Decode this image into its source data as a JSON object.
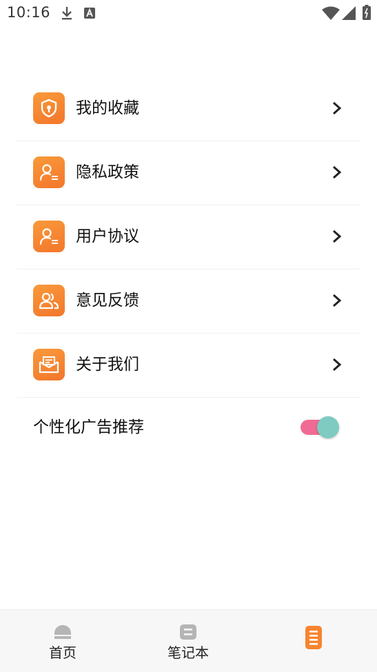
{
  "status_bar": {
    "time": "10:16"
  },
  "menu": {
    "items": [
      {
        "label": "我的收藏",
        "icon": "shield-icon"
      },
      {
        "label": "隐私政策",
        "icon": "user-doc-icon"
      },
      {
        "label": "用户协议",
        "icon": "user-doc-icon"
      },
      {
        "label": "意见反馈",
        "icon": "users-icon"
      },
      {
        "label": "关于我们",
        "icon": "mail-icon"
      }
    ],
    "chevron": ">"
  },
  "ad_toggle": {
    "label": "个性化广告推荐",
    "enabled": true
  },
  "bottom_nav": {
    "items": [
      {
        "label": "首页"
      },
      {
        "label": "笔记本"
      },
      {
        "label": "",
        "active": true
      }
    ]
  },
  "colors": {
    "accent": "#f7842f",
    "toggle_track": "#f06b93",
    "toggle_knob": "#7fcbc1",
    "nav_icon_gray": "#b5b5b5"
  }
}
